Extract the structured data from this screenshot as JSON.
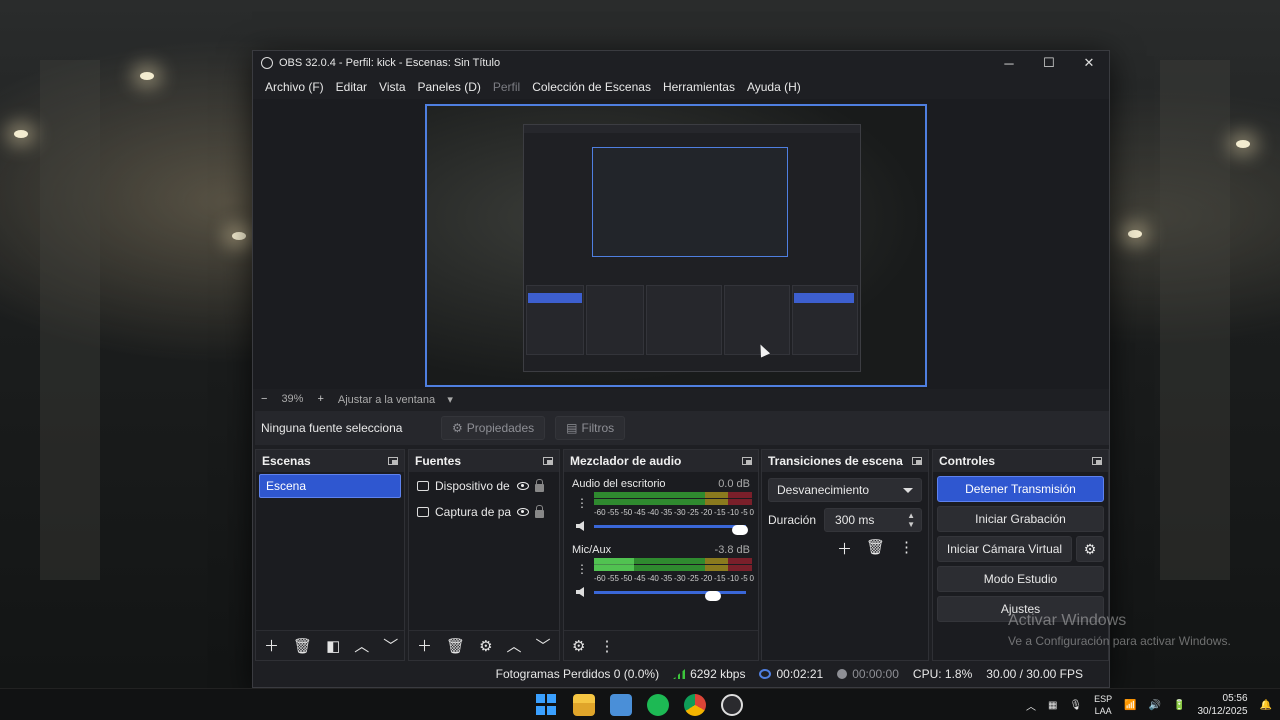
{
  "window": {
    "title": "OBS 32.0.4 - Perfil: kick - Escenas: Sin Título",
    "minimize": "─",
    "maximize": "☐",
    "close": "✕"
  },
  "menu": {
    "items": [
      "Archivo (F)",
      "Editar",
      "Vista",
      "Paneles (D)",
      "Perfil",
      "Colección de Escenas",
      "Herramientas",
      "Ayuda (H)"
    ]
  },
  "zoom": {
    "minus": "−",
    "value": "39%",
    "plus": "+",
    "fit": "Ajustar a la ventana"
  },
  "source_toolbar": {
    "no_source": "Ninguna fuente selecciona",
    "properties": "Propiedades",
    "filters": "Filtros"
  },
  "scenes": {
    "title": "Escenas",
    "items": [
      "Escena"
    ]
  },
  "sources": {
    "title": "Fuentes",
    "items": [
      {
        "label": "Dispositivo de",
        "icon": "camera-icon"
      },
      {
        "label": "Captura de par",
        "icon": "monitor-icon"
      }
    ]
  },
  "mixer": {
    "title": "Mezclador de audio",
    "scale": [
      "-60",
      "-55",
      "-50",
      "-45",
      "-40",
      "-35",
      "-30",
      "-25",
      "-20",
      "-15",
      "-10",
      "-5",
      "0"
    ],
    "channels": [
      {
        "name": "Audio del escritorio",
        "db": "0.0 dB",
        "level": 0.0,
        "volume": 1.0
      },
      {
        "name": "Mic/Aux",
        "db": "-3.8 dB",
        "level": 0.25,
        "volume": 0.82
      }
    ]
  },
  "transitions": {
    "title": "Transiciones de escena",
    "selected": "Desvanecimiento",
    "duration_label": "Duración",
    "duration_value": "300 ms"
  },
  "controls": {
    "title": "Controles",
    "stop_stream": "Detener Transmisión",
    "start_recording": "Iniciar Grabación",
    "start_virtual_cam": "Iniciar Cámara Virtual",
    "studio_mode": "Modo Estudio",
    "settings": "Ajustes"
  },
  "status": {
    "dropped_frames": "Fotogramas Perdidos 0 (0.0%)",
    "bitrate": "6292 kbps",
    "stream_time": "00:02:21",
    "rec_time": "00:00:00",
    "cpu": "CPU: 1.8%",
    "fps": "30.00 / 30.00 FPS"
  },
  "watermark": {
    "line1": "Activar Windows",
    "line2": "Ve a Configuración para activar Windows."
  },
  "taskbar": {
    "lang1": "ESP",
    "lang2": "LAA",
    "time": "05:56",
    "date": "30/12/2025"
  },
  "colors": {
    "accent": "#2f57d0",
    "panel_bg": "#1b1c20",
    "meter_green": "#2f8a2f",
    "meter_red": "#7a1f2a"
  }
}
